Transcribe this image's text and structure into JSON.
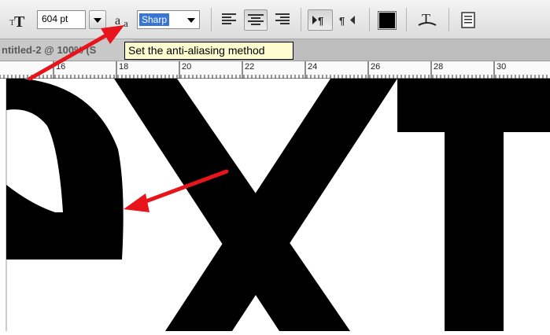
{
  "options_bar": {
    "font_size_value": "604 pt",
    "anti_alias_value": "Sharp",
    "tooltip": "Set the anti-aliasing method",
    "icons": {
      "text_orientation": "toggle-text-orientation-icon",
      "anti_alias": "anti-aliasing-aa-icon",
      "align_left": "align-left-icon",
      "align_center": "align-center-icon",
      "align_right": "align-right-icon",
      "ltr": "left-to-right-paragraph-icon",
      "rtl": "right-to-left-paragraph-icon",
      "text_color": "text-color-swatch",
      "warp": "warp-text-icon",
      "panels": "character-paragraph-panels-icon"
    },
    "text_color": "#000000"
  },
  "document_tab": {
    "title": "ntitled-2 @ 100% (S"
  },
  "ruler": {
    "labels": [
      "16",
      "18",
      "20",
      "22",
      "24",
      "26",
      "28",
      "30"
    ]
  },
  "annotations": {
    "arrow_color": "#e8141c"
  }
}
